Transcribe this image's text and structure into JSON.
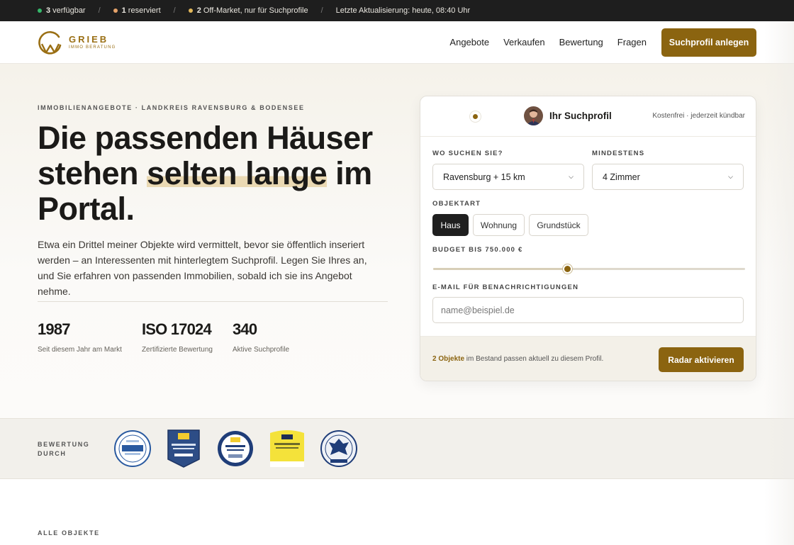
{
  "topbar": {
    "items": [
      {
        "count": "3",
        "label": "verfügbar",
        "dot_color": "#35b86a"
      },
      {
        "count": "1",
        "label": "reserviert",
        "dot_color": "#e6a36a"
      },
      {
        "count": "2",
        "label": "Off-Market, nur für Suchprofile",
        "dot_color": "#e2b85a"
      }
    ],
    "separator": "/",
    "updated": "Letzte Aktualisierung: heute, 08:40 Uhr"
  },
  "header": {
    "logo": {
      "name": "GRIEB",
      "sub": "IMMO BERATUNG"
    },
    "nav": [
      "Angebote",
      "Verkaufen",
      "Bewertung",
      "Fragen"
    ],
    "cta": "Suchprofil anlegen"
  },
  "hero": {
    "eyebrow": "IMMOBILIENANGEBOTE · LANDKREIS RAVENSBURG & BODENSEE",
    "headline_part1": "Die passenden Häuser stehen ",
    "headline_highlight": "selten lange",
    "headline_part2": " im Portal.",
    "lead": "Etwa ein Drittel meiner Objekte wird vermittelt, bevor sie öffentlich inseriert werden – an Interessenten mit hinterlegtem Suchprofil. Legen Sie Ihres an, und Sie erfahren von passenden Immobilien, sobald ich sie ins Angebot nehme.",
    "stats": [
      {
        "value": "1987",
        "label": "Seit diesem Jahr am Markt"
      },
      {
        "value": "ISO 17024",
        "label": "Zertifizierte Bewertung"
      },
      {
        "value": "340",
        "label": "Aktive Suchprofile"
      }
    ]
  },
  "card": {
    "title": "Ihr Suchprofil",
    "note": "Kostenfrei · jederzeit kündbar",
    "where_label": "WO SUCHEN SIE?",
    "where_value": "Ravensburg + 15 km",
    "min_label": "MINDESTENS",
    "min_value": "4 Zimmer",
    "type_label": "OBJEKTART",
    "types": [
      "Haus",
      "Wohnung",
      "Grundstück"
    ],
    "active_type": "Haus",
    "budget_label": "BUDGET BIS 750.000 €",
    "budget_fraction": 0.43,
    "email_label": "E-MAIL FÜR BENACHRICHTIGUNGEN",
    "email_placeholder": "name@beispiel.de",
    "foot_count": "2 Objekte",
    "foot_text": " im Bestand passen aktuell zu diesem Profil.",
    "cta": "Radar aktivieren"
  },
  "ratings": {
    "label": "BEWERTUNG DURCH",
    "seals": [
      "certified-seal",
      "certificate-badge",
      "round-certificate-seal",
      "dia-badge",
      "eagle-member-seal"
    ]
  },
  "section": {
    "eyebrow": "ALLE OBJEKTE"
  },
  "colors": {
    "accent": "#8b6410",
    "dark": "#1e1e1e",
    "highlight": "#ead9b3"
  }
}
